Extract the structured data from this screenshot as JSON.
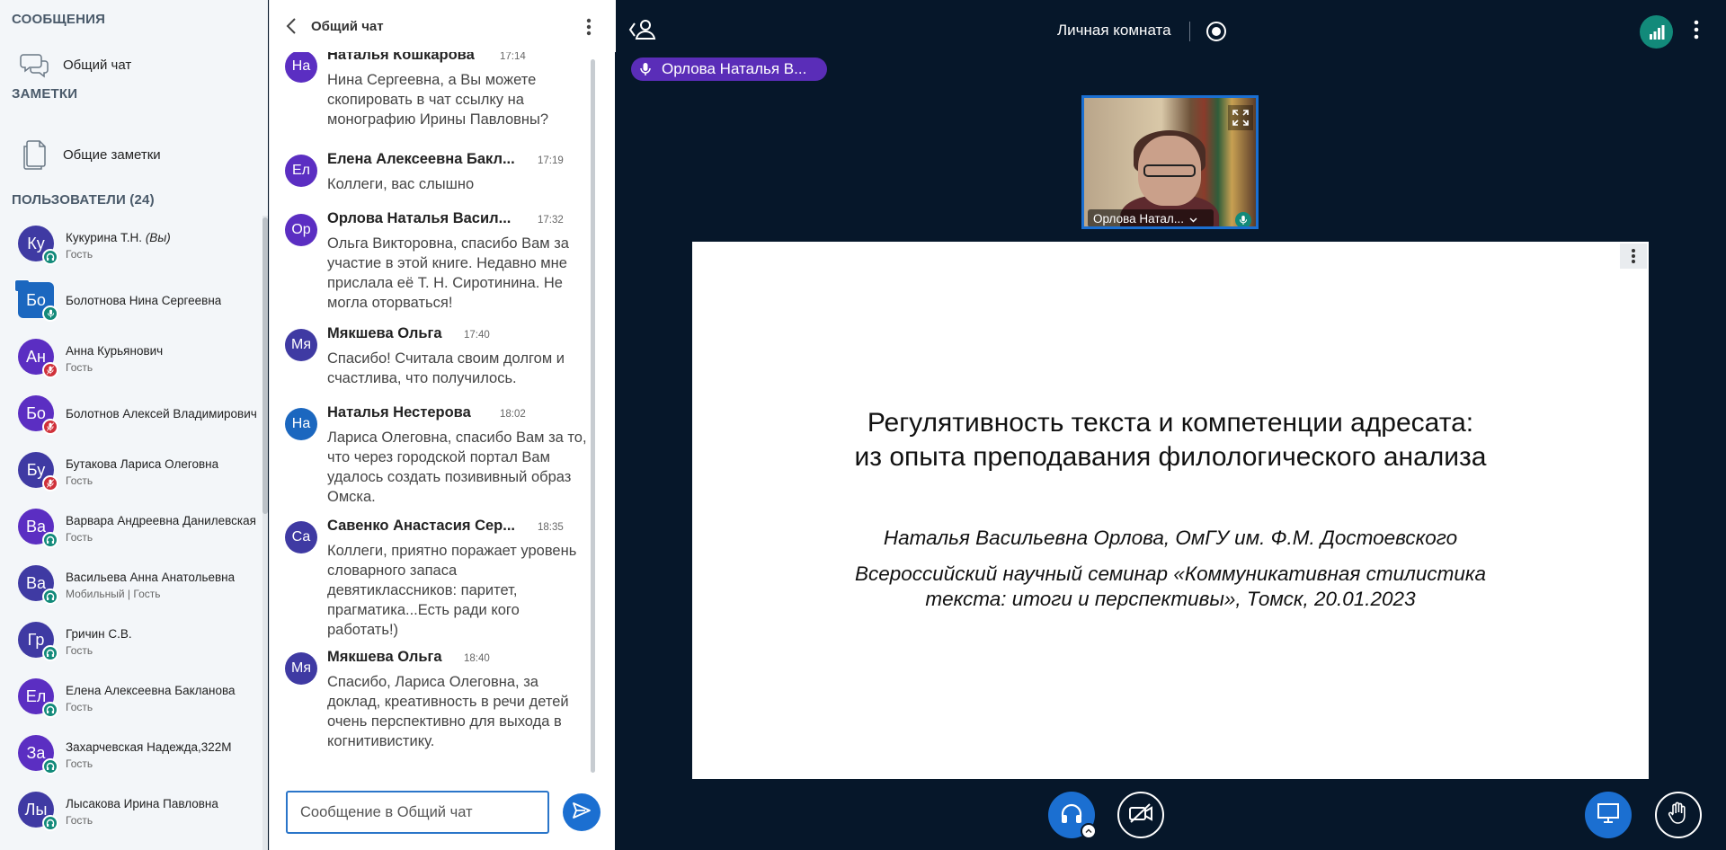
{
  "sidebar": {
    "messages_title": "СООБЩЕНИЯ",
    "public_chat": "Общий чат",
    "notes_title": "ЗАМЕТКИ",
    "shared_notes": "Общие заметки",
    "users_title": "ПОЛЬЗОВАТЕЛИ (24)",
    "users": [
      {
        "initials": "Ку",
        "name": "Кукурина Т.Н.",
        "you_tag": "(Вы)",
        "role": "Гость",
        "color": "#3f3aa3",
        "status": "listen"
      },
      {
        "initials": "Бо",
        "name": "Болотнова Нина Сергеевна",
        "role": "",
        "color": "#1b67bf",
        "status": "mic"
      },
      {
        "initials": "Ан",
        "name": "Анна Курьянович",
        "role": "Гость",
        "color": "#5b2ec2",
        "status": "muted"
      },
      {
        "initials": "Бо",
        "name": "Болотнов Алексей Владимирович",
        "role": "",
        "color": "#5b2ec2",
        "status": "muted"
      },
      {
        "initials": "Бу",
        "name": "Бутакова Лариса Олеговна",
        "role": "Гость",
        "color": "#3f3aa3",
        "status": "muted"
      },
      {
        "initials": "Ва",
        "name": "Варвара Андреевна Данилевская",
        "role": "Гость",
        "color": "#5b2ec2",
        "status": "listen"
      },
      {
        "initials": "Ва",
        "name": "Васильева Анна Анатольевна",
        "role": "Мобильный | Гость",
        "color": "#3f3aa3",
        "status": "listen"
      },
      {
        "initials": "Гр",
        "name": "Гричин С.В.",
        "role": "Гость",
        "color": "#3f3aa3",
        "status": "listen"
      },
      {
        "initials": "Ел",
        "name": "Елена Алексеевна Бакланова",
        "role": "Гость",
        "color": "#5b2ec2",
        "status": "listen"
      },
      {
        "initials": "За",
        "name": "Захарчевская Надежда,322М",
        "role": "Гость",
        "color": "#5b2ec2",
        "status": "listen"
      },
      {
        "initials": "Лы",
        "name": "Лысакова Ирина Павловна",
        "role": "Гость",
        "color": "#3f3aa3",
        "status": "listen"
      }
    ]
  },
  "chat": {
    "title": "Общий чат",
    "input_placeholder": "Сообщение в Общий чат",
    "messages": [
      {
        "initials": "На",
        "name": "Наталья Кошкарова",
        "time": "17:14",
        "text": "Нина Сергеевна, а Вы можете скопировать в чат ссылку на монографию Ирины Павловны?",
        "color": "#5b2ec2"
      },
      {
        "initials": "Ел",
        "name": "Елена Алексеевна Бакл...",
        "time": "17:19",
        "text": "Коллеги, вас слышно",
        "color": "#5b2ec2"
      },
      {
        "initials": "Ор",
        "name": "Орлова Наталья Васил...",
        "time": "17:32",
        "text": "Ольга Викторовна, спасибо Вам за участие в этой книге. Недавно мне прислала её Т. Н. Сиротинина. Не могла оторваться!",
        "color": "#5b2ec2"
      },
      {
        "initials": "Мя",
        "name": "Мякшева Ольга",
        "time": "17:40",
        "text": "Спасибо! Считала своим долгом и счастлива, что получилось.",
        "color": "#3f3aa3"
      },
      {
        "initials": "На",
        "name": "Наталья Нестерова",
        "time": "18:02",
        "text": "Лариса Олеговна, спасибо Вам за то, что через городской портал Вам удалось создать позививный образ Омска.",
        "color": "#1b67bf"
      },
      {
        "initials": "Са",
        "name": "Савенко Анастасия Сер...",
        "time": "18:35",
        "text": "Коллеги, приятно поражает уровень словарного запаса девятиклассников: паритет, прагматика...Есть ради кого работать!)",
        "color": "#3f3aa3"
      },
      {
        "initials": "Мя",
        "name": "Мякшева Ольга",
        "time": "18:40",
        "text": "Спасибо, Лариса Олеговна, за доклад, креативность в речи детей очень перспективно для выхода в когнитивистику.",
        "color": "#3f3aa3"
      }
    ]
  },
  "stage": {
    "room_title": "Личная комната",
    "talker": "Орлова Наталья В...",
    "camera_label": "Орлова Натал...",
    "slide": {
      "title_line1": "Регулятивность текста и компетенции адресата:",
      "title_line2": "из опыта преподавания филологического анализа",
      "author": "Наталья Васильевна Орлова, ОмГУ им. Ф.М. Достоевского",
      "event_line1": "Всероссийский научный семинар «Коммуникативная стилистика",
      "event_line2": "текста: итоги и перспективы», Томск,  20.01.2023"
    }
  },
  "colors": {
    "accent": "#1b6fd1",
    "listen": "#128a7a",
    "muted": "#d0313a",
    "talker": "#5a2db8",
    "stage_bg": "#06172a"
  }
}
